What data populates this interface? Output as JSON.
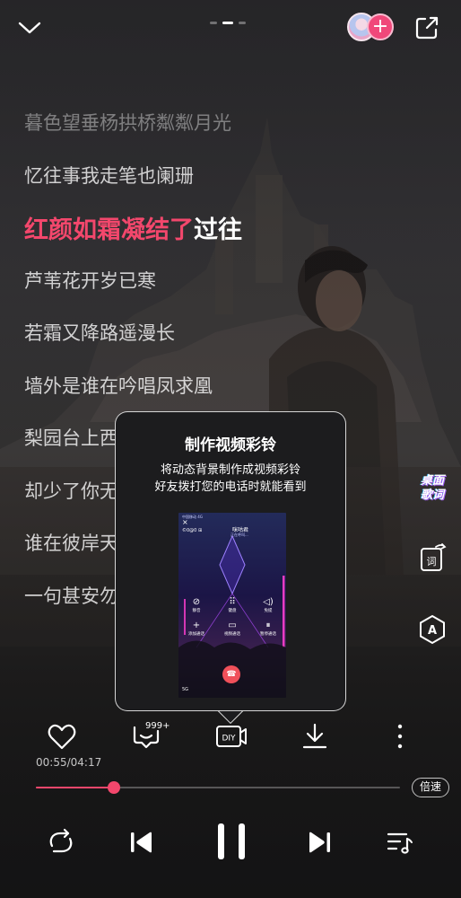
{
  "lyrics": [
    {
      "text": "暮色望垂杨拱桥粼粼月光",
      "state": "dim"
    },
    {
      "text": "忆往事我走笔也阑珊",
      "state": "normal"
    },
    {
      "sung": "红颜如霜凝结了",
      "unsung": "过往",
      "state": "current"
    },
    {
      "text": "芦苇花开岁已寒",
      "state": "normal"
    },
    {
      "text": "若霜又降路遥漫长",
      "state": "normal"
    },
    {
      "text": "墙外是谁在吟唱凤求凰",
      "state": "normal"
    },
    {
      "text": "梨园台上西皮二黄",
      "state": "normal"
    },
    {
      "text": "却少了你无人问暖",
      "state": "normal"
    },
    {
      "text": "谁在彼岸天涯一方",
      "state": "normal"
    },
    {
      "text": "一句甚安勿念你说",
      "state": "normal"
    }
  ],
  "side": {
    "desk_lyric_line1": "桌面",
    "desk_lyric_line2": "歌词"
  },
  "popover": {
    "title": "制作视频彩铃",
    "desc_line1": "将动态背景制作成视频彩铃",
    "desc_line2": "好友拨打您的电话时就能看到",
    "preview": {
      "status": "中国移动 4G",
      "left_text": "©0@0 ⊞",
      "caller": "咪咕君",
      "sub": "正在呼叫...",
      "buttons": [
        {
          "glyph": "⊘",
          "label": "静音"
        },
        {
          "glyph": "⠿",
          "label": "键盘"
        },
        {
          "glyph": "◁)",
          "label": "免提"
        },
        {
          "glyph": "+",
          "label": "添加通话"
        },
        {
          "glyph": "▭",
          "label": "视频通话"
        },
        {
          "glyph": "⏸",
          "label": "暂停通话"
        }
      ],
      "network": "5G"
    }
  },
  "actions": {
    "comment_count": "999+",
    "diy_label": "DIY"
  },
  "playback": {
    "time": "00:55/04:17",
    "progress": 0.215,
    "speed_label": "倍速"
  },
  "colors": {
    "accent": "#f3476c",
    "avatar_add": "#f0487a"
  },
  "icons": {
    "collapse": "chevron-down-icon",
    "share": "share-out-icon",
    "like": "heart-icon",
    "comment": "comment-icon",
    "diy": "diy-video-icon",
    "download": "download-icon",
    "more": "more-vertical-icon",
    "loop": "loop-icon",
    "prev": "skip-previous-icon",
    "play": "pause-icon",
    "next": "skip-next-icon",
    "queue": "playlist-icon"
  }
}
